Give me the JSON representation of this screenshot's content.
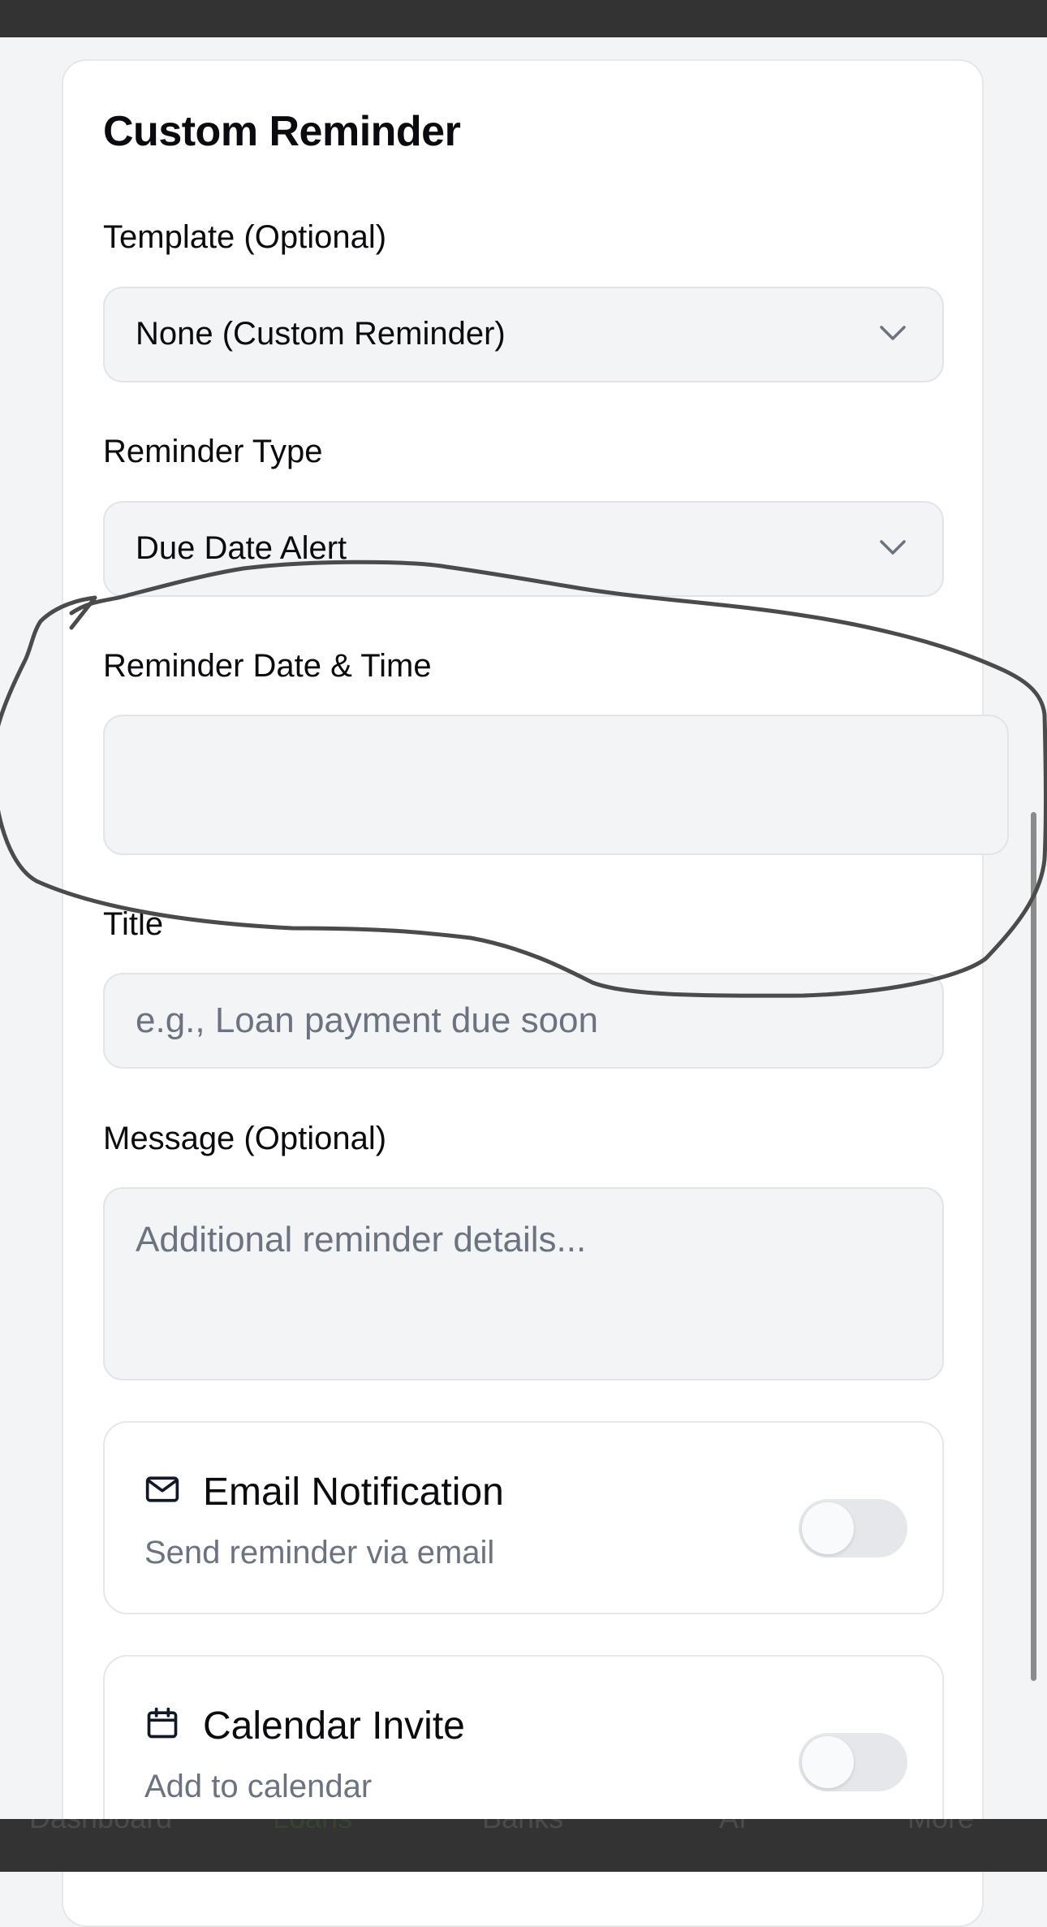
{
  "colors": {
    "screen_background": "#f3f4f6",
    "card_background": "#ffffff",
    "field_background": "#f3f4f6",
    "placeholder_text": "#6b7280",
    "bar": "#333333",
    "annotation_stroke": "#4b4b4b"
  },
  "form": {
    "heading": "Custom Reminder",
    "template": {
      "label": "Template (Optional)",
      "value": "None (Custom Reminder)",
      "icon": "chevron-down-icon"
    },
    "reminder_type": {
      "label": "Reminder Type",
      "value": "Due Date Alert",
      "icon": "chevron-down-icon"
    },
    "reminder_datetime": {
      "label": "Reminder Date & Time",
      "value": ""
    },
    "title": {
      "label": "Title",
      "placeholder": "e.g., Loan payment due soon",
      "value": ""
    },
    "message": {
      "label": "Message (Optional)",
      "placeholder": "Additional reminder details...",
      "value": ""
    },
    "email_notification": {
      "title": "Email Notification",
      "subtitle": "Send reminder via email",
      "icon": "mail-icon",
      "enabled": false
    },
    "calendar_invite": {
      "title": "Calendar Invite",
      "subtitle": "Add to calendar",
      "icon": "calendar-icon",
      "enabled": false
    }
  },
  "bottom_nav": {
    "items": [
      {
        "label": "Dashboard",
        "active": false
      },
      {
        "label": "Loans",
        "active": true
      },
      {
        "label": "Banks",
        "active": false
      },
      {
        "label": "AI",
        "active": false
      },
      {
        "label": "More",
        "active": false
      }
    ]
  },
  "annotation": {
    "shape": "hand-drawn loop",
    "target": "Reminder Date & Time"
  }
}
